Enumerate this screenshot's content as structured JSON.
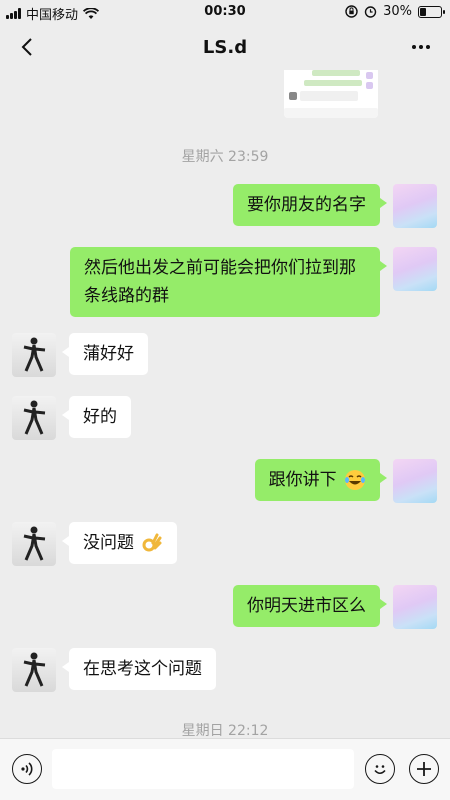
{
  "status_bar": {
    "carrier": "中国移动",
    "time": "00:30",
    "battery_percent": "30%",
    "battery_level": 0.3
  },
  "nav": {
    "title": "LS.d",
    "back_icon": "chevron-left-icon",
    "more_icon": "ellipsis-icon"
  },
  "timestamps": [
    "星期六 23:59",
    "星期日 22:12"
  ],
  "messages": [
    {
      "side": "out",
      "text": "要你朋友的名字"
    },
    {
      "side": "out",
      "text": "然后他出发之前可能会把你们拉到那条线路的群"
    },
    {
      "side": "in",
      "text": "蒲好好"
    },
    {
      "side": "in",
      "text": "好的"
    },
    {
      "side": "out",
      "text": "跟你讲下",
      "emoji": "laughing-tears-emoji"
    },
    {
      "side": "in",
      "text": "没问题",
      "emoji": "ok-hand-emoji"
    },
    {
      "side": "out",
      "text": "你明天进市区么"
    },
    {
      "side": "in",
      "text": "在思考这个问题"
    }
  ],
  "input_bar": {
    "voice_icon": "voice-icon",
    "emoji_icon": "smiley-icon",
    "plus_icon": "plus-icon",
    "value": ""
  },
  "colors": {
    "background": "#ededed",
    "outgoing_bubble": "#95ec69",
    "incoming_bubble": "#ffffff",
    "timestamp_text": "#a3a3a3"
  }
}
